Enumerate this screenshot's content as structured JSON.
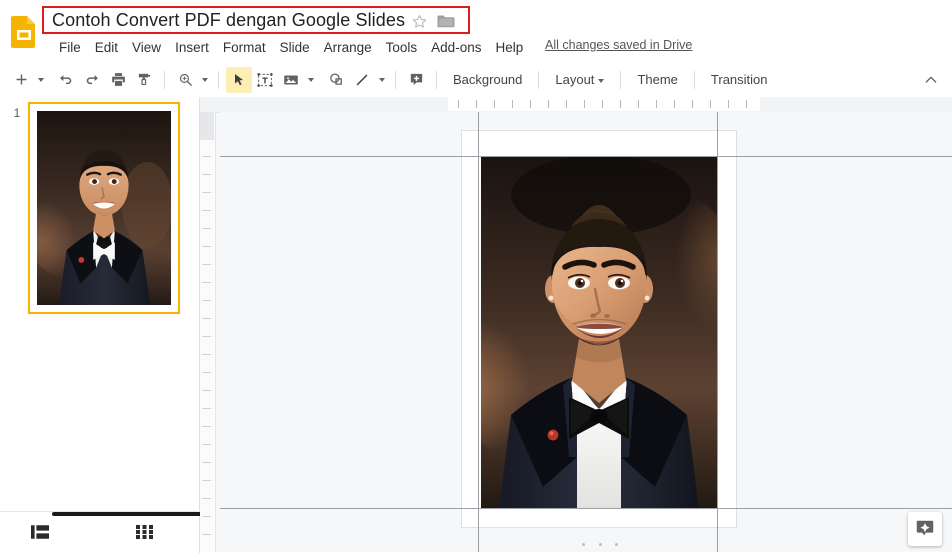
{
  "app": {
    "name": "Google Slides",
    "logo_icon": "slides-document-icon"
  },
  "header": {
    "document_title": "Contoh Convert PDF dengan Google Slides",
    "star_icon": "star-outline-icon",
    "folder_icon": "folder-icon",
    "highlight_color": "#e01b1b",
    "save_status": "All changes saved in Drive",
    "menus": [
      {
        "label": "File"
      },
      {
        "label": "Edit"
      },
      {
        "label": "View"
      },
      {
        "label": "Insert"
      },
      {
        "label": "Format"
      },
      {
        "label": "Slide"
      },
      {
        "label": "Arrange"
      },
      {
        "label": "Tools"
      },
      {
        "label": "Add-ons"
      },
      {
        "label": "Help"
      }
    ]
  },
  "toolbar": {
    "buttons": [
      {
        "name": "new-slide-button",
        "icon": "plus-icon",
        "tooltip": "New slide"
      },
      {
        "name": "new-slide-dropdown",
        "icon": "chevron-down-icon"
      },
      {
        "name": "undo-button",
        "icon": "undo-icon",
        "tooltip": "Undo"
      },
      {
        "name": "redo-button",
        "icon": "redo-icon",
        "tooltip": "Redo"
      },
      {
        "name": "print-button",
        "icon": "print-icon",
        "tooltip": "Print"
      },
      {
        "name": "paint-format-button",
        "icon": "paint-roller-icon",
        "tooltip": "Paint format"
      },
      {
        "name": "zoom-button",
        "icon": "magnifier-plus-icon",
        "tooltip": "Zoom"
      },
      {
        "name": "zoom-dropdown",
        "icon": "chevron-down-icon"
      },
      {
        "name": "select-tool-button",
        "icon": "cursor-arrow-icon",
        "tooltip": "Select"
      },
      {
        "name": "textbox-button",
        "icon": "text-box-icon",
        "tooltip": "Text box"
      },
      {
        "name": "image-button",
        "icon": "image-icon",
        "tooltip": "Insert image"
      },
      {
        "name": "image-dropdown",
        "icon": "chevron-down-icon"
      },
      {
        "name": "shape-button",
        "icon": "shape-icon",
        "tooltip": "Shape"
      },
      {
        "name": "line-button",
        "icon": "line-icon",
        "tooltip": "Line"
      },
      {
        "name": "line-dropdown",
        "icon": "chevron-down-icon"
      },
      {
        "name": "comment-button",
        "icon": "add-comment-icon",
        "tooltip": "Add comment"
      }
    ],
    "active_tool": "select-tool-button",
    "active_tool_highlight": "#fdeeb4",
    "text_buttons": [
      {
        "name": "background-button",
        "label": "Background",
        "has_caret": false
      },
      {
        "name": "layout-button",
        "label": "Layout",
        "has_caret": true
      },
      {
        "name": "theme-button",
        "label": "Theme",
        "has_caret": false
      },
      {
        "name": "transition-button",
        "label": "Transition",
        "has_caret": false
      }
    ],
    "collapse_icon": "chevron-up-icon"
  },
  "sidebar": {
    "slides": [
      {
        "number": "1",
        "selected": true,
        "selection_color": "#f4b400"
      }
    ],
    "footer": {
      "filmstrip_view_icon": "filmstrip-view-icon",
      "grid_view_icon": "grid-view-icon"
    }
  },
  "editor": {
    "ruler_horizontal": "horizontal-ruler",
    "ruler_vertical": "vertical-ruler",
    "slide_canvas": "slide-canvas",
    "selected_object": "image-portrait",
    "drag_handle": "resize-dots-handle",
    "explore_icon": "explore-star-icon"
  }
}
